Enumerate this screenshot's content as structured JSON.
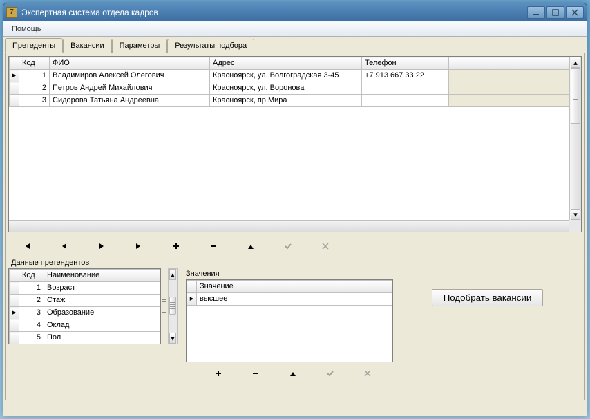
{
  "window": {
    "title": "Экспертная система отдела кадров"
  },
  "menu": {
    "help": "Помощь"
  },
  "tabs": {
    "items": [
      "Претеденты",
      "Вакансии",
      "Параметры",
      "Результаты подбора"
    ],
    "activeIndex": 0
  },
  "applicants": {
    "headers": {
      "code": "Код",
      "fio": "ФИО",
      "address": "Адрес",
      "phone": "Телефон"
    },
    "rows": [
      {
        "code": "1",
        "fio": "Владимиров Алексей Олегович",
        "address": "Красноярск, ул. Волгоградская 3-45",
        "phone": "+7 913 667 33 22"
      },
      {
        "code": "2",
        "fio": "Петров Андрей Михайлович",
        "address": "Красноярск, ул. Воронова",
        "phone": ""
      },
      {
        "code": "3",
        "fio": "Сидорова Татьяна Андреевна",
        "address": "Красноярск, пр.Мира",
        "phone": ""
      }
    ],
    "currentRow": 0
  },
  "params": {
    "section_label": "Данные претендентов",
    "headers": {
      "code": "Код",
      "name": "Наименование"
    },
    "rows": [
      {
        "code": "1",
        "name": "Возраст"
      },
      {
        "code": "2",
        "name": "Стаж"
      },
      {
        "code": "3",
        "name": "Образование"
      },
      {
        "code": "4",
        "name": "Оклад"
      },
      {
        "code": "5",
        "name": "Пол"
      }
    ],
    "currentRow": 2
  },
  "values": {
    "section_label": "Значения",
    "headers": {
      "value": "Значение"
    },
    "rows": [
      {
        "value": "высшее"
      }
    ],
    "currentRow": 0
  },
  "buttons": {
    "pick_vacancies": "Подобрать вакансии"
  }
}
